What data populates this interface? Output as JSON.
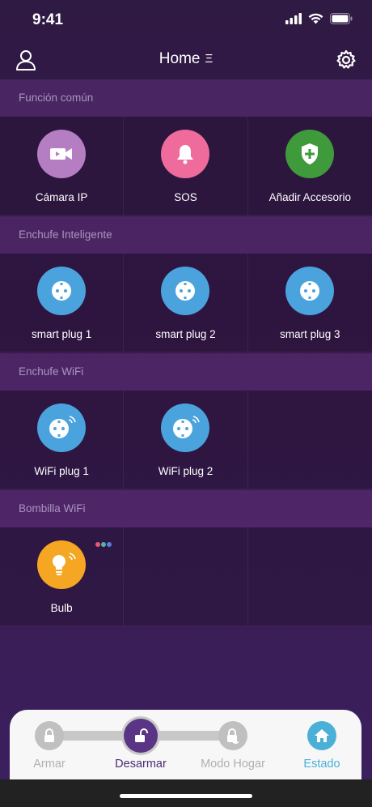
{
  "status": {
    "time": "9:41"
  },
  "header": {
    "title": "Home",
    "menu_glyph": "Ξ"
  },
  "sections": [
    {
      "title": "Función común",
      "items": [
        {
          "label": "Cámara IP",
          "icon": "camera-icon",
          "color": "#b57ec3"
        },
        {
          "label": "SOS",
          "icon": "bell-icon",
          "color": "#ee6b9c"
        },
        {
          "label": "Añadir Accesorio",
          "icon": "shield-plus-icon",
          "color": "#3f9a3c"
        }
      ]
    },
    {
      "title": "Enchufe Inteligente",
      "items": [
        {
          "label": "smart plug 1",
          "icon": "socket-icon",
          "color": "#4aa3dd"
        },
        {
          "label": "smart plug 2",
          "icon": "socket-icon",
          "color": "#4aa3dd"
        },
        {
          "label": "smart plug 3",
          "icon": "socket-icon",
          "color": "#4aa3dd"
        }
      ]
    },
    {
      "title": "Enchufe WiFi",
      "items": [
        {
          "label": "WiFi plug 1",
          "icon": "wifi-socket-icon",
          "color": "#4aa3dd"
        },
        {
          "label": "WiFi plug 2",
          "icon": "wifi-socket-icon",
          "color": "#4aa3dd"
        }
      ]
    },
    {
      "title": "Bombilla WiFi",
      "items": [
        {
          "label": "Bulb",
          "icon": "bulb-icon",
          "color": "#f5a623"
        }
      ]
    }
  ],
  "modes": [
    {
      "label": "Armar",
      "icon": "lock-icon",
      "active": false
    },
    {
      "label": "Desarmar",
      "icon": "unlock-icon",
      "active": true
    },
    {
      "label": "Modo Hogar",
      "icon": "home-lock-icon",
      "active": false
    },
    {
      "label": "Estado",
      "icon": "house-icon",
      "active": false
    }
  ],
  "colors": {
    "accent_purple": "#5a3585",
    "estado_blue": "#4ab0d8",
    "inactive_grey": "#c0c0c0"
  }
}
